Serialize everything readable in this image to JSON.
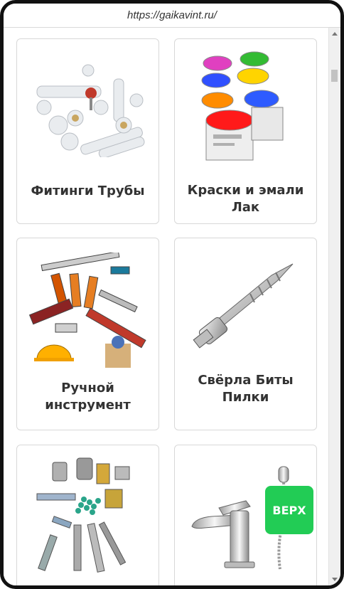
{
  "browser": {
    "url": "https://gaikavint.ru/"
  },
  "categories": [
    {
      "title": "Фитинги Трубы",
      "image": "pipe-fittings-image"
    },
    {
      "title": "Краски и эмали Лак",
      "image": "paint-cans-image"
    },
    {
      "title": "Ручной инструмент",
      "image": "hand-tools-image"
    },
    {
      "title": "Свёрла Биты Пилки",
      "image": "drill-bit-image"
    },
    {
      "title": "",
      "image": "fasteners-image"
    },
    {
      "title": "",
      "image": "faucet-image"
    }
  ],
  "scroll_top": {
    "label": "ВЕРХ",
    "color": "#22cc55"
  }
}
